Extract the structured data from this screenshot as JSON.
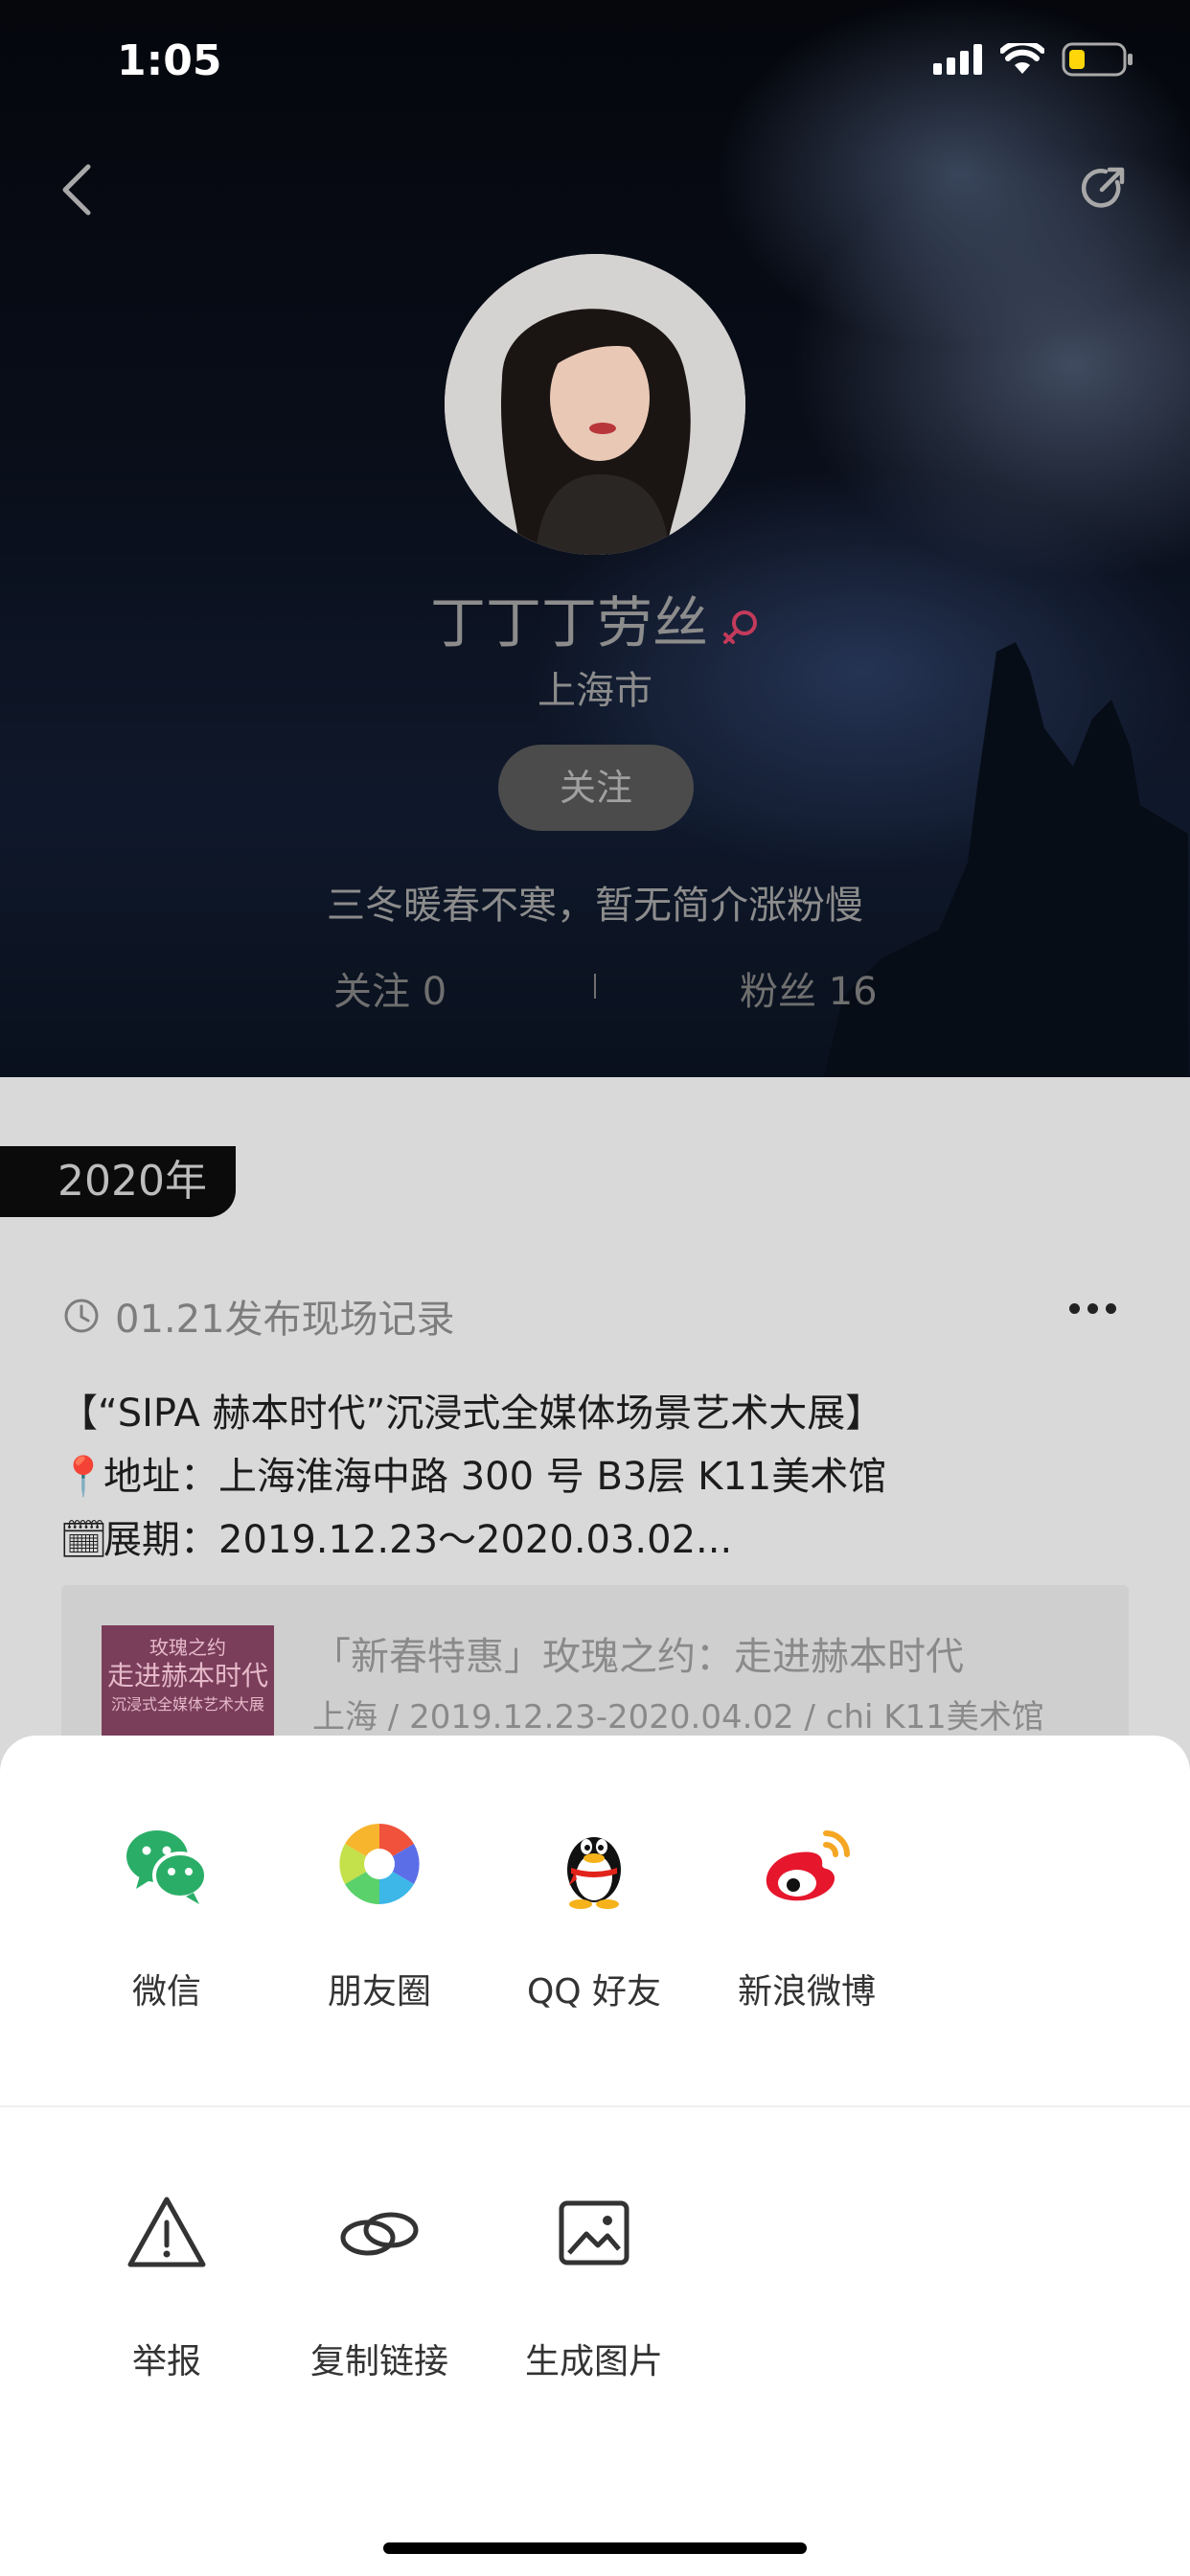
{
  "status_bar": {
    "time": "1:05"
  },
  "profile": {
    "name": "丁丁丁劳丝",
    "city": "上海市",
    "follow_label": "关注",
    "bio": "三冬暖春不寒，暂无简介涨粉慢",
    "following_text": "关注 0",
    "fans_text": "粉丝 16"
  },
  "feed": {
    "year_label": "2020年",
    "post": {
      "meta": "01.21发布现场记录",
      "lines": [
        "【“SIPA 赫本时代”沉浸式全媒体场景艺术大展】",
        "地址：上海淮海中路 300 号 B3层 K11美术馆",
        "展期：2019.12.23～2020.03.02..."
      ],
      "event": {
        "title": "「新春特惠」玫瑰之约：走进赫本时代",
        "subtitle": "上海 / 2019.12.23-2020.04.02 / chi K11美术馆",
        "thumb_lines": [
          "玫瑰之约",
          "走进赫本时代",
          "沉浸式全媒体艺术大展"
        ]
      }
    }
  },
  "share_sheet": {
    "share_targets": [
      {
        "label": "微信",
        "icon": "wechat-icon"
      },
      {
        "label": "朋友圈",
        "icon": "moments-icon"
      },
      {
        "label": "QQ 好友",
        "icon": "qq-icon"
      },
      {
        "label": "新浪微博",
        "icon": "weibo-icon"
      }
    ],
    "actions": [
      {
        "label": "举报",
        "icon": "warning-icon"
      },
      {
        "label": "复制链接",
        "icon": "link-icon"
      },
      {
        "label": "生成图片",
        "icon": "image-icon"
      }
    ]
  }
}
